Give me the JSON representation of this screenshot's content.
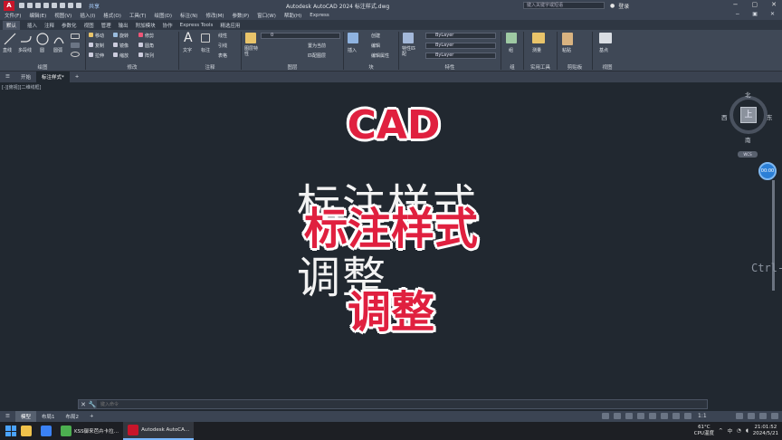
{
  "titlebar": {
    "app_logo": "A",
    "share": "共享",
    "title": "Autodesk AutoCAD 2024   标注样式.dwg",
    "search_placeholder": "键入关键字或短语",
    "user": "登录"
  },
  "menu": [
    "文件(F)",
    "编辑(E)",
    "视图(V)",
    "插入(I)",
    "格式(O)",
    "工具(T)",
    "绘图(D)",
    "标注(N)",
    "修改(M)",
    "参数(P)",
    "窗口(W)",
    "帮助(H)",
    "Express"
  ],
  "ribbon_tabs": [
    "默认",
    "插入",
    "注释",
    "参数化",
    "视图",
    "管理",
    "输出",
    "附加模块",
    "协作",
    "Express Tools",
    "精选应用"
  ],
  "ribbon": {
    "draw": {
      "label": "绘图",
      "line": "直线",
      "polyline": "多段线",
      "circle": "圆",
      "arc": "圆弧"
    },
    "modify": {
      "label": "修改",
      "move": "移动",
      "rotate": "旋转",
      "trim": "修剪",
      "copy": "复制",
      "mirror": "镜像",
      "fillet": "圆角",
      "stretch": "拉伸",
      "scale": "缩放",
      "array": "阵列"
    },
    "annotation": {
      "label": "注释",
      "text": "文字",
      "dim": "标注",
      "linear": "线性",
      "leader": "引线",
      "table": "表格"
    },
    "layers": {
      "label": "图层",
      "props": "图层特性",
      "current": "置为当前",
      "match": "匹配图层",
      "layer_value": "0"
    },
    "block": {
      "label": "块",
      "insert": "插入",
      "create": "创建",
      "edit": "编辑",
      "edit_attr": "编辑属性"
    },
    "properties": {
      "label": "特性",
      "match": "特性匹配",
      "bylayer1": "ByLayer",
      "bylayer2": "ByLayer",
      "bylayer3": "ByLayer"
    },
    "groups": {
      "label": "组",
      "group": "组"
    },
    "utilities": {
      "label": "实用工具",
      "measure": "测量"
    },
    "clipboard": {
      "label": "剪贴板",
      "paste": "粘贴"
    },
    "view": {
      "label": "视图",
      "base": "基点"
    }
  },
  "doc_tabs": [
    "开始",
    "标注样式*"
  ],
  "viewport_label": "[-][俯视][二维线框]",
  "drawing": {
    "line1": "标注样式",
    "line2": "调整"
  },
  "overlay": {
    "title": "CAD",
    "subtitle": "标注样式",
    "subtitle2": "调整"
  },
  "viewcube": {
    "north": "北",
    "south": "南",
    "east": "东",
    "west": "西",
    "top": "上",
    "wcs": "WCS"
  },
  "timer": "00:00",
  "ctrl_hint": "Ctrl-",
  "command": {
    "placeholder": "键入命令"
  },
  "layout_tabs": [
    "模型",
    "布局1",
    "布局2"
  ],
  "status": {
    "scale": "1:1"
  },
  "taskbar": {
    "apps": [
      "KSS御来芭卉卡拉…",
      "Autodesk AutoCA…"
    ],
    "temp": "61°C",
    "temp_label": "CPU温度",
    "time": "21:01:52",
    "date": "2024/5/21",
    "lang": "中"
  }
}
